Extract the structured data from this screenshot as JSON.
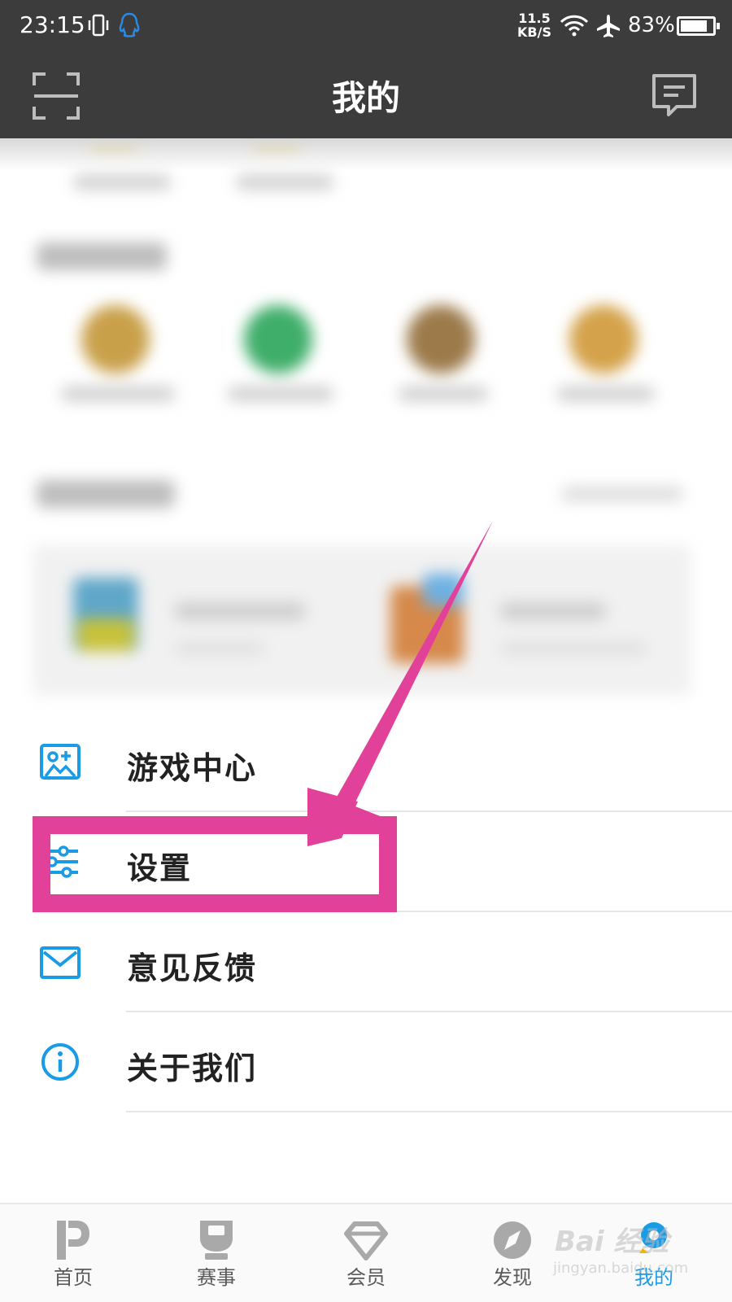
{
  "status_bar": {
    "time": "23:15",
    "net_speed_value": "11.5",
    "net_speed_unit": "KB/S",
    "battery_percent": "83%",
    "battery_level": 0.83
  },
  "header": {
    "title": "我的",
    "scan_icon": "scan-icon",
    "message_icon": "message-icon"
  },
  "menu": {
    "items": [
      {
        "label": "游戏中心",
        "icon": "game-center-icon"
      },
      {
        "label": "设置",
        "icon": "settings-sliders-icon"
      },
      {
        "label": "意见反馈",
        "icon": "mail-icon"
      },
      {
        "label": "关于我们",
        "icon": "info-icon"
      }
    ]
  },
  "bottom_nav": {
    "items": [
      {
        "label": "首页",
        "icon": "home-icon"
      },
      {
        "label": "赛事",
        "icon": "trophy-icon"
      },
      {
        "label": "会员",
        "icon": "diamond-icon"
      },
      {
        "label": "发现",
        "icon": "compass-icon"
      },
      {
        "label": "我的",
        "icon": "profile-icon",
        "active": true
      }
    ]
  },
  "watermark": {
    "top": "Bai 经验",
    "bottom": "jingyan.baidu.com"
  },
  "colors": {
    "header_bg": "#3c3c3c",
    "accent_blue": "#1a9be6",
    "annotation_pink": "#e2419a"
  }
}
